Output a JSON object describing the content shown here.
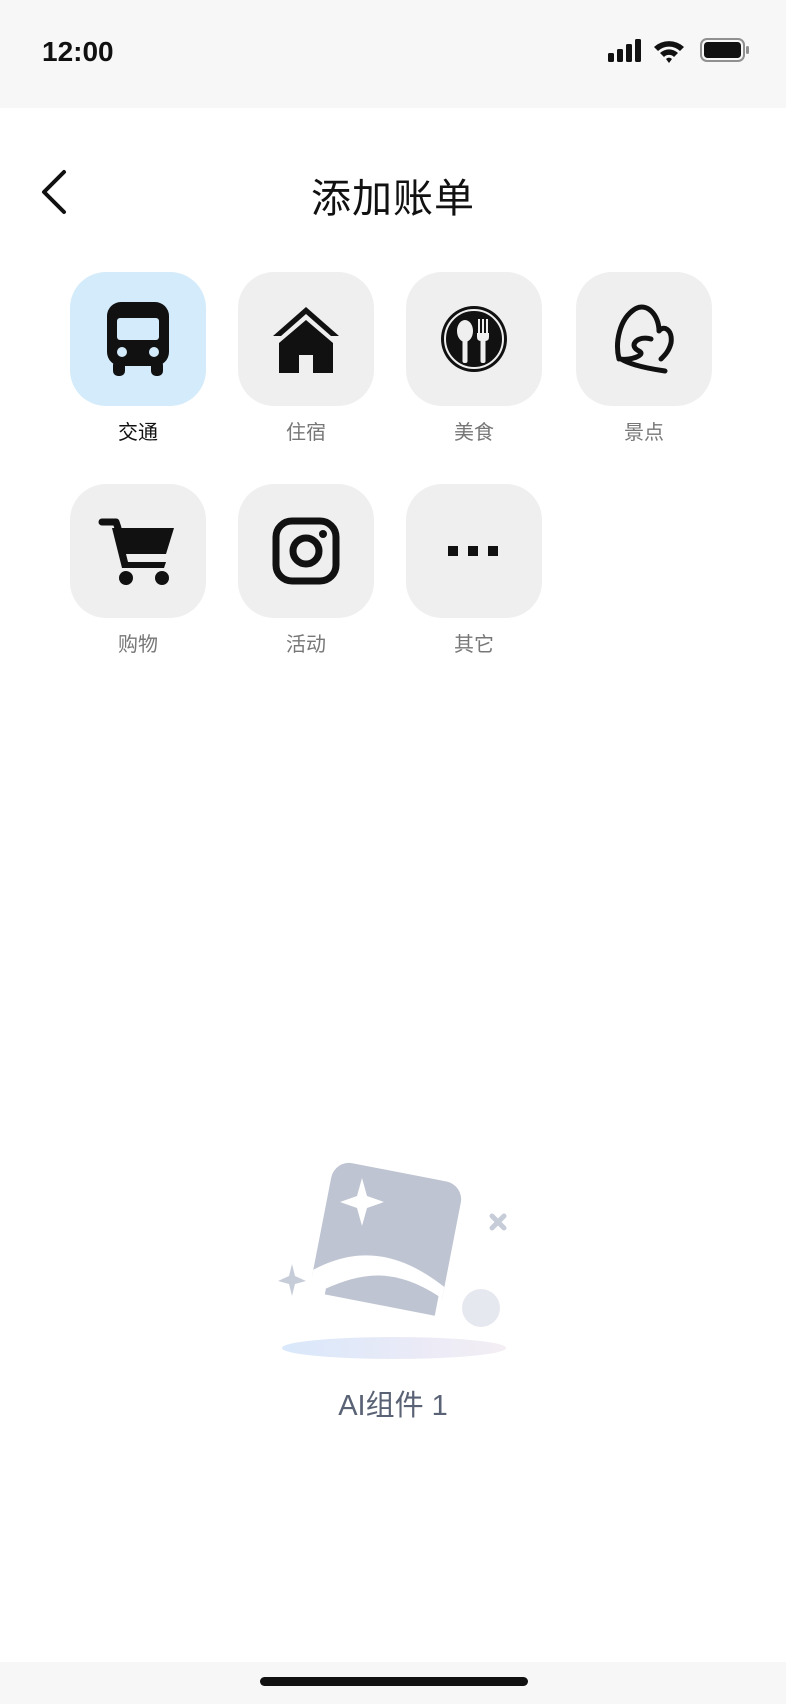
{
  "status_bar": {
    "time": "12:00",
    "icons": [
      "signal-icon",
      "wifi-icon",
      "battery-icon"
    ]
  },
  "header": {
    "title": "添加账单",
    "back_icon": "chevron-left-icon"
  },
  "categories": [
    {
      "label": "交通",
      "icon": "bus-icon",
      "selected": true
    },
    {
      "label": "住宿",
      "icon": "house-icon",
      "selected": false
    },
    {
      "label": "美食",
      "icon": "dining-icon",
      "selected": false
    },
    {
      "label": "景点",
      "icon": "landmark-icon",
      "selected": false
    },
    {
      "label": "购物",
      "icon": "cart-icon",
      "selected": false
    },
    {
      "label": "活动",
      "icon": "camera-icon",
      "selected": false
    },
    {
      "label": "其它",
      "icon": "more-icon",
      "selected": false
    }
  ],
  "ai_widget": {
    "label": "AI组件 1",
    "illustration": "image-placeholder-icon"
  },
  "colors": {
    "selected_tile": "#d3ebfa",
    "tile": "#efefef",
    "label_selected": "#111111",
    "label_default": "#777777",
    "illustration": "#bec4d1"
  }
}
